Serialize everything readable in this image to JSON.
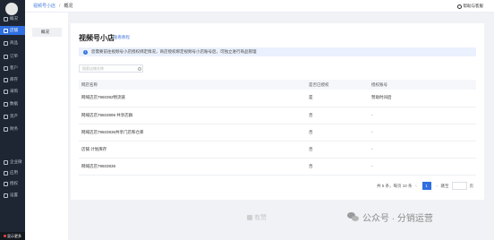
{
  "sidebar": {
    "items": [
      {
        "label": "概况",
        "icon": "home-icon",
        "active": false
      },
      {
        "label": "店铺",
        "icon": "store-icon",
        "active": true
      },
      {
        "label": "商品",
        "icon": "goods-icon",
        "active": false
      },
      {
        "label": "订单",
        "icon": "order-icon",
        "active": false
      },
      {
        "label": "客户",
        "icon": "customer-icon",
        "active": false
      },
      {
        "label": "库存",
        "icon": "inventory-icon",
        "active": false
      },
      {
        "label": "采购",
        "icon": "purchase-icon",
        "active": false
      },
      {
        "label": "数据",
        "icon": "data-icon",
        "active": false
      },
      {
        "label": "资产",
        "icon": "asset-icon",
        "active": false
      },
      {
        "label": "财务",
        "icon": "finance-icon",
        "active": false
      },
      {
        "label": "企业微",
        "icon": "wecom-icon",
        "active": false
      },
      {
        "label": "应用",
        "icon": "apps-icon",
        "active": false
      },
      {
        "label": "授权",
        "icon": "auth-icon",
        "active": false
      },
      {
        "label": "设置",
        "icon": "settings-icon",
        "active": false
      }
    ],
    "bottom_label": "显示更多"
  },
  "header": {
    "breadcrumb": [
      "视频号小店",
      "概况"
    ],
    "help_label": "帮助与客服"
  },
  "subnav": {
    "items": [
      "概况"
    ]
  },
  "main": {
    "title": "视频号小店",
    "help_link": "查看教程",
    "notice": "您需要前往视频号小店授权绑定情况，商店授权绑定视频号小店账号后，可独立进行商品管理",
    "search_placeholder": "搜索店铺名称",
    "table": {
      "headers": [
        "网店名称",
        "是否已授权",
        "授权账号"
      ],
      "rows": [
        [
          "网域店店7960392物流链",
          "是",
          "赞助时间后"
        ],
        [
          "网域店店79603999 共享店群",
          "否",
          "-"
        ],
        [
          "网域店店79603936共享门店和仓库",
          "否",
          "-"
        ],
        [
          "店铺 计划库存",
          "否",
          "-"
        ],
        [
          "网域店店79603938",
          "否",
          "-"
        ]
      ]
    },
    "pagination": {
      "summary": "共 5 条，每页 10 条",
      "current_page": "1",
      "goto_label": "跳至",
      "page_suffix": "页"
    }
  },
  "footer": {
    "like_text": "有赞",
    "wechat_text": "公众号 · 分销运营"
  },
  "colors": {
    "accent": "#2f6fe0",
    "sidebar_bg": "#1f2633",
    "notice_bg": "#eaf1fd"
  }
}
